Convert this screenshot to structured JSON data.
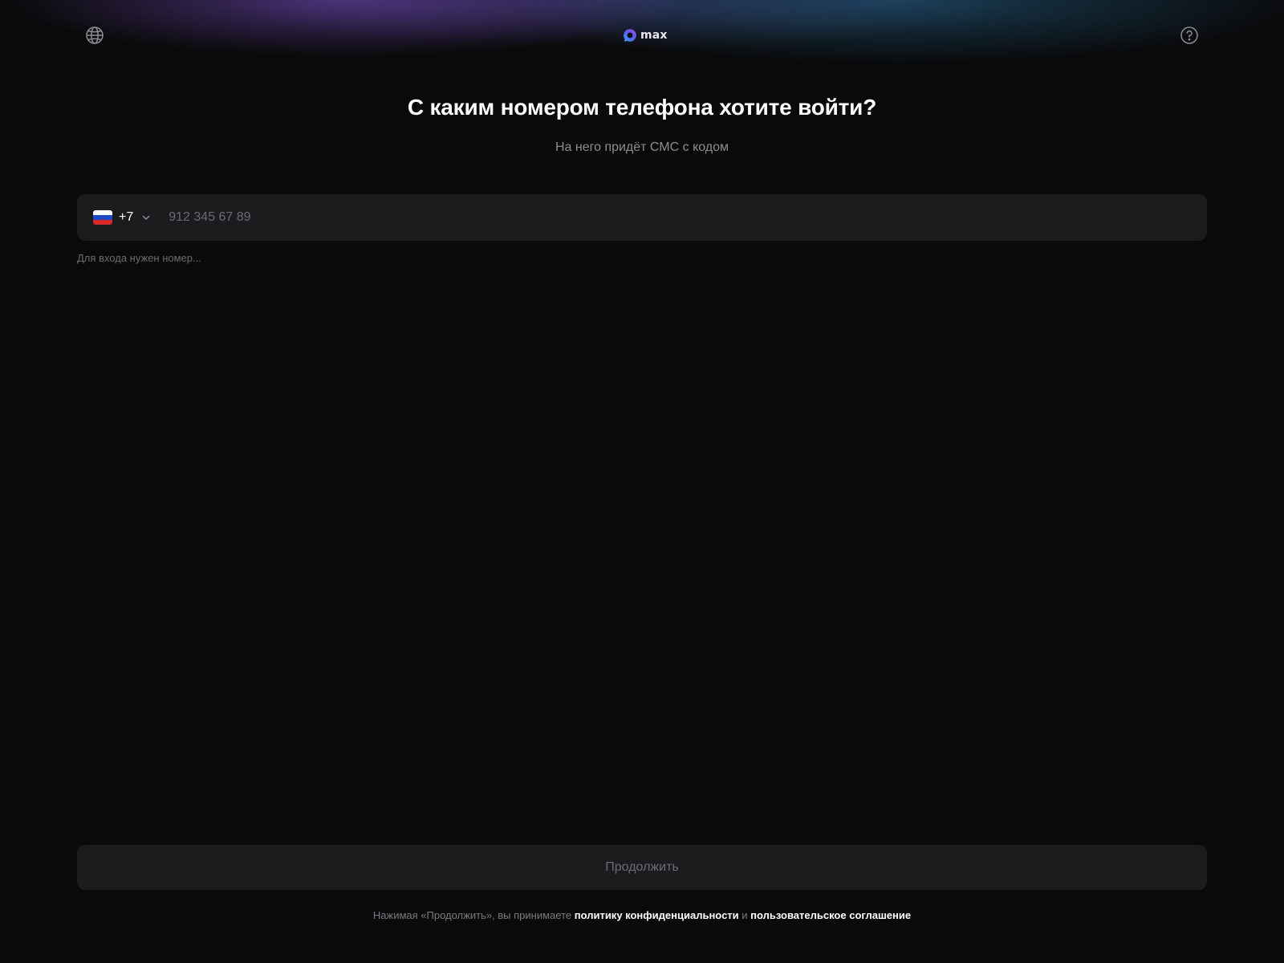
{
  "header": {
    "language_icon": "globe-icon",
    "help_icon": "question-circle-icon",
    "logo_text": "max"
  },
  "main": {
    "title": "С каким номером телефона хотите войти?",
    "subtitle": "На него придёт СМС с кодом",
    "phone": {
      "country_flag": "russia-flag",
      "country_code": "+7",
      "placeholder": "912 345 67 89",
      "value": ""
    },
    "hint": "Для входа нужен номер..."
  },
  "footer": {
    "continue_label": "Продолжить",
    "terms_prefix": "Нажимая «Продолжить», вы принимаете ",
    "privacy_link": "политику конфиденциальности",
    "terms_and": " и ",
    "agreement_link": "пользовательское соглашение"
  },
  "colors": {
    "background": "#0a0a0b",
    "field_background": "#1c1c1e",
    "muted_text": "#8c8c93",
    "placeholder_text": "#6b6b71"
  }
}
